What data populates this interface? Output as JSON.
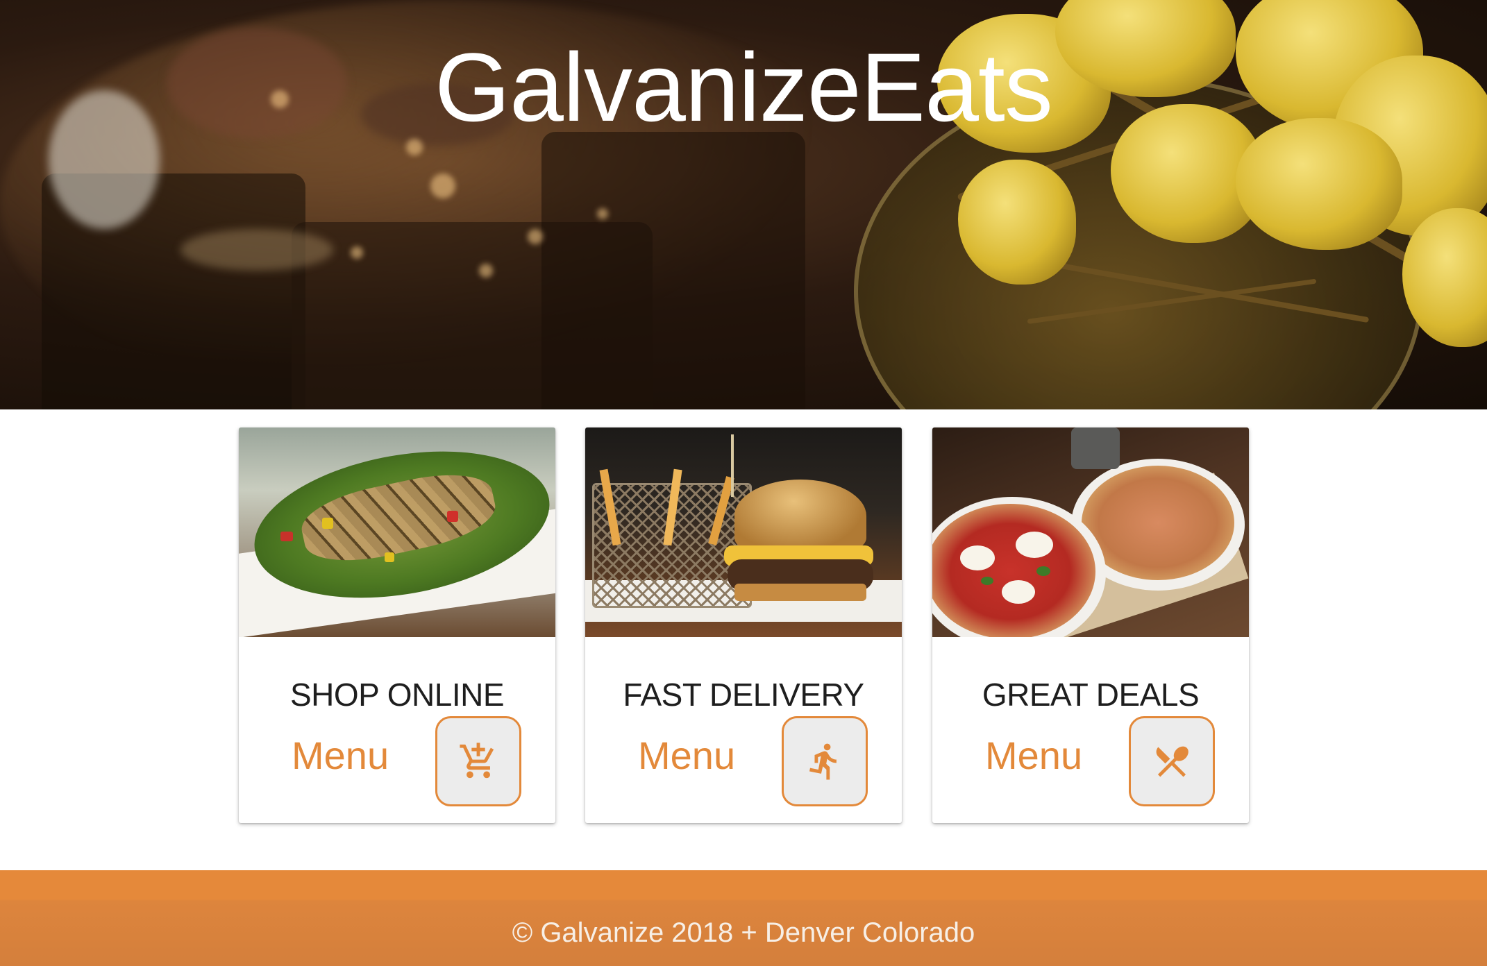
{
  "hero": {
    "title": "GalvanizeEats"
  },
  "cards": [
    {
      "title": "SHOP ONLINE",
      "link_label": "Menu",
      "icon": "add-shopping-cart-icon"
    },
    {
      "title": "FAST DELIVERY",
      "link_label": "Menu",
      "icon": "running-person-icon"
    },
    {
      "title": "GREAT DEALS",
      "link_label": "Menu",
      "icon": "fork-spoon-icon"
    }
  ],
  "footer": {
    "text": "© Galvanize 2018 + Denver Colorado"
  },
  "colors": {
    "accent": "#e3893a",
    "footer_bg": "#e5893a",
    "button_bg": "#ececec",
    "title_text": "#1e1e1e"
  }
}
